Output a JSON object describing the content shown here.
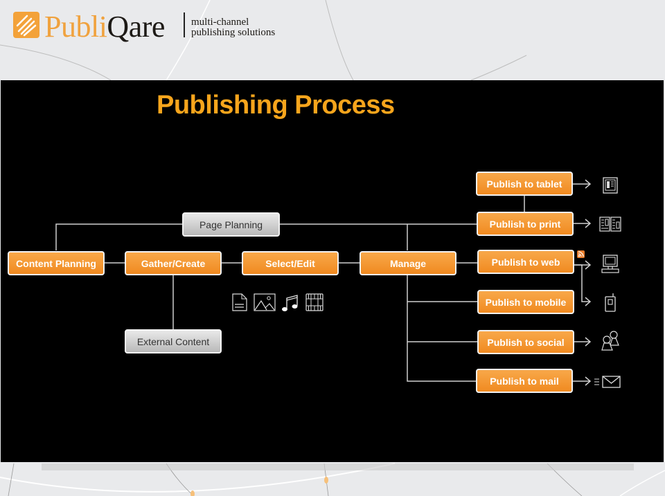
{
  "header": {
    "brand_part1": "Publi",
    "brand_part2": "Qare",
    "tagline_line1": "multi-channel",
    "tagline_line2": "publishing solutions",
    "logo_icon": "publiqare-logo-icon"
  },
  "slide": {
    "title": "Publishing Process",
    "colors": {
      "accent": "#f7a51c",
      "box_orange": "#f39a2f",
      "box_gray": "#cfcfcf",
      "background": "#000000"
    }
  },
  "diagram": {
    "main_flow": [
      "Content Planning",
      "Gather/Create",
      "Select/Edit",
      "Manage"
    ],
    "page_planning": "Page Planning",
    "external_content": "External Content",
    "content_type_icons": [
      "document-icon",
      "image-icon",
      "music-icon",
      "video-icon"
    ],
    "outputs": [
      {
        "label": "Publish to tablet",
        "icon": "tablet-icon"
      },
      {
        "label": "Publish to print",
        "icon": "print-icon"
      },
      {
        "label": "Publish to web",
        "icon": "computer-icon",
        "badge": "rss-icon"
      },
      {
        "label": "Publish to mobile",
        "icon": "mobile-icon"
      },
      {
        "label": "Publish to social",
        "icon": "social-icon"
      },
      {
        "label": "Publish to mail",
        "icon": "mail-icon"
      }
    ]
  }
}
